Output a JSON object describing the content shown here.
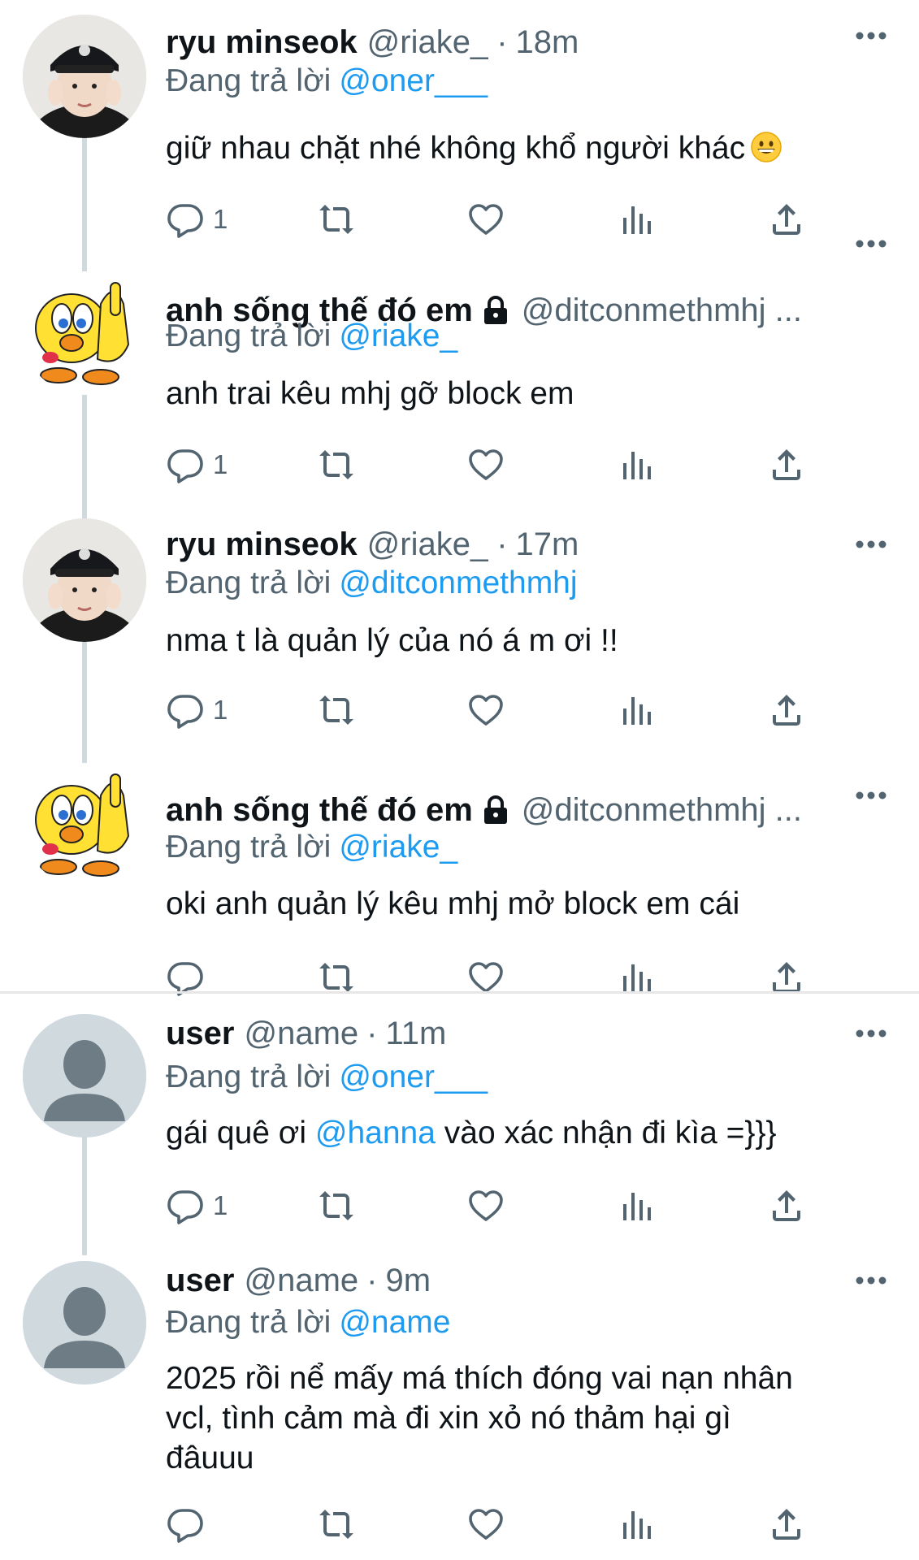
{
  "colors": {
    "link": "#1d9bf0",
    "muted": "#536471",
    "text": "#0f1419",
    "thread_line": "#cfd9de"
  },
  "reply_prefix": "Đang trả lời",
  "tweets": [
    {
      "name": "ryu minseok",
      "handle": "@riake_",
      "time": "18m",
      "reply_to": "@oner___",
      "text": "giữ nhau chặt nhé không khổ người khác",
      "emoji": "grinning-face",
      "reply_count": "1",
      "avatar": "photo-boy-black-cap"
    },
    {
      "name": "anh sống thế đó em",
      "handle": "@ditconmethmhj ...",
      "time": "",
      "reply_to": "@riake_",
      "text": "anh trai kêu mhj gỡ block em",
      "reply_count": "1",
      "locked": true,
      "avatar": "yellow-bird-cartoon"
    },
    {
      "name": "ryu minseok",
      "handle": "@riake_",
      "time": "17m",
      "reply_to": "@ditconmethmhj",
      "text": "nma t là quản lý của nó á m ơi !!",
      "reply_count": "1",
      "avatar": "photo-boy-black-cap"
    },
    {
      "name": "anh sống thế đó em",
      "handle": "@ditconmethmhj ...",
      "time": "",
      "reply_to": "@riake_",
      "text": "oki anh quản lý kêu mhj mở block em cái",
      "reply_count": "",
      "locked": true,
      "avatar": "yellow-bird-cartoon"
    },
    {
      "name": "user",
      "handle": "@name",
      "time": "11m",
      "reply_to": "@oner___",
      "text_before": "gái quê ơi",
      "text_mention": "@hanna",
      "text_after": "vào xác nhận đi kìa =}}}",
      "reply_count": "1",
      "avatar": "default-avatar"
    },
    {
      "name": "user",
      "handle": "@name",
      "time": "9m",
      "reply_to": "@name",
      "text_lines": [
        "2025 rồi nể mấy má thích đóng vai nạn nhân",
        "vcl, tình cảm mà đi xin xỏ nó thảm hại gì",
        "đâuuu"
      ],
      "reply_count": "",
      "avatar": "default-avatar"
    }
  ],
  "icons": [
    "reply-icon",
    "retweet-icon",
    "like-icon",
    "views-icon",
    "share-icon",
    "more-icon",
    "lock-icon"
  ]
}
